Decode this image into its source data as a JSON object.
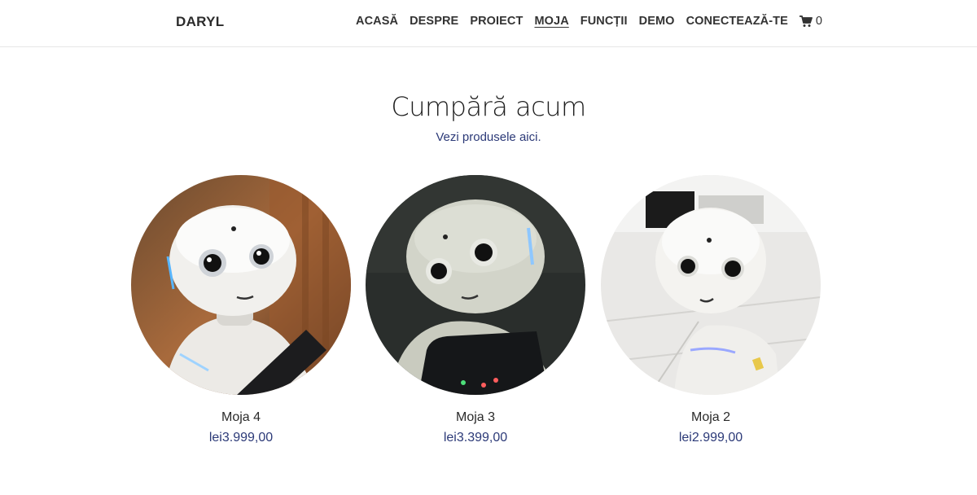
{
  "header": {
    "brand": "DARYL",
    "nav": [
      "ACASĂ",
      "DESPRE",
      "PROIECT",
      "MOJA",
      "FUNCȚII",
      "DEMO",
      "CONECTEAZĂ-TE"
    ],
    "active_nav": "MOJA",
    "cart_count": "0",
    "cart_icon": "cart-icon"
  },
  "hero": {
    "title": "Cumpără acum",
    "subtitle": "Vezi produsele aici."
  },
  "products": [
    {
      "name": "Moja 4",
      "price": "lei3.999,00"
    },
    {
      "name": "Moja 3",
      "price": "lei3.399,00"
    },
    {
      "name": "Moja 2",
      "price": "lei2.999,00"
    }
  ],
  "colors": {
    "accent": "#2c3a78",
    "text": "#222222",
    "border": "#e6e6e6"
  }
}
